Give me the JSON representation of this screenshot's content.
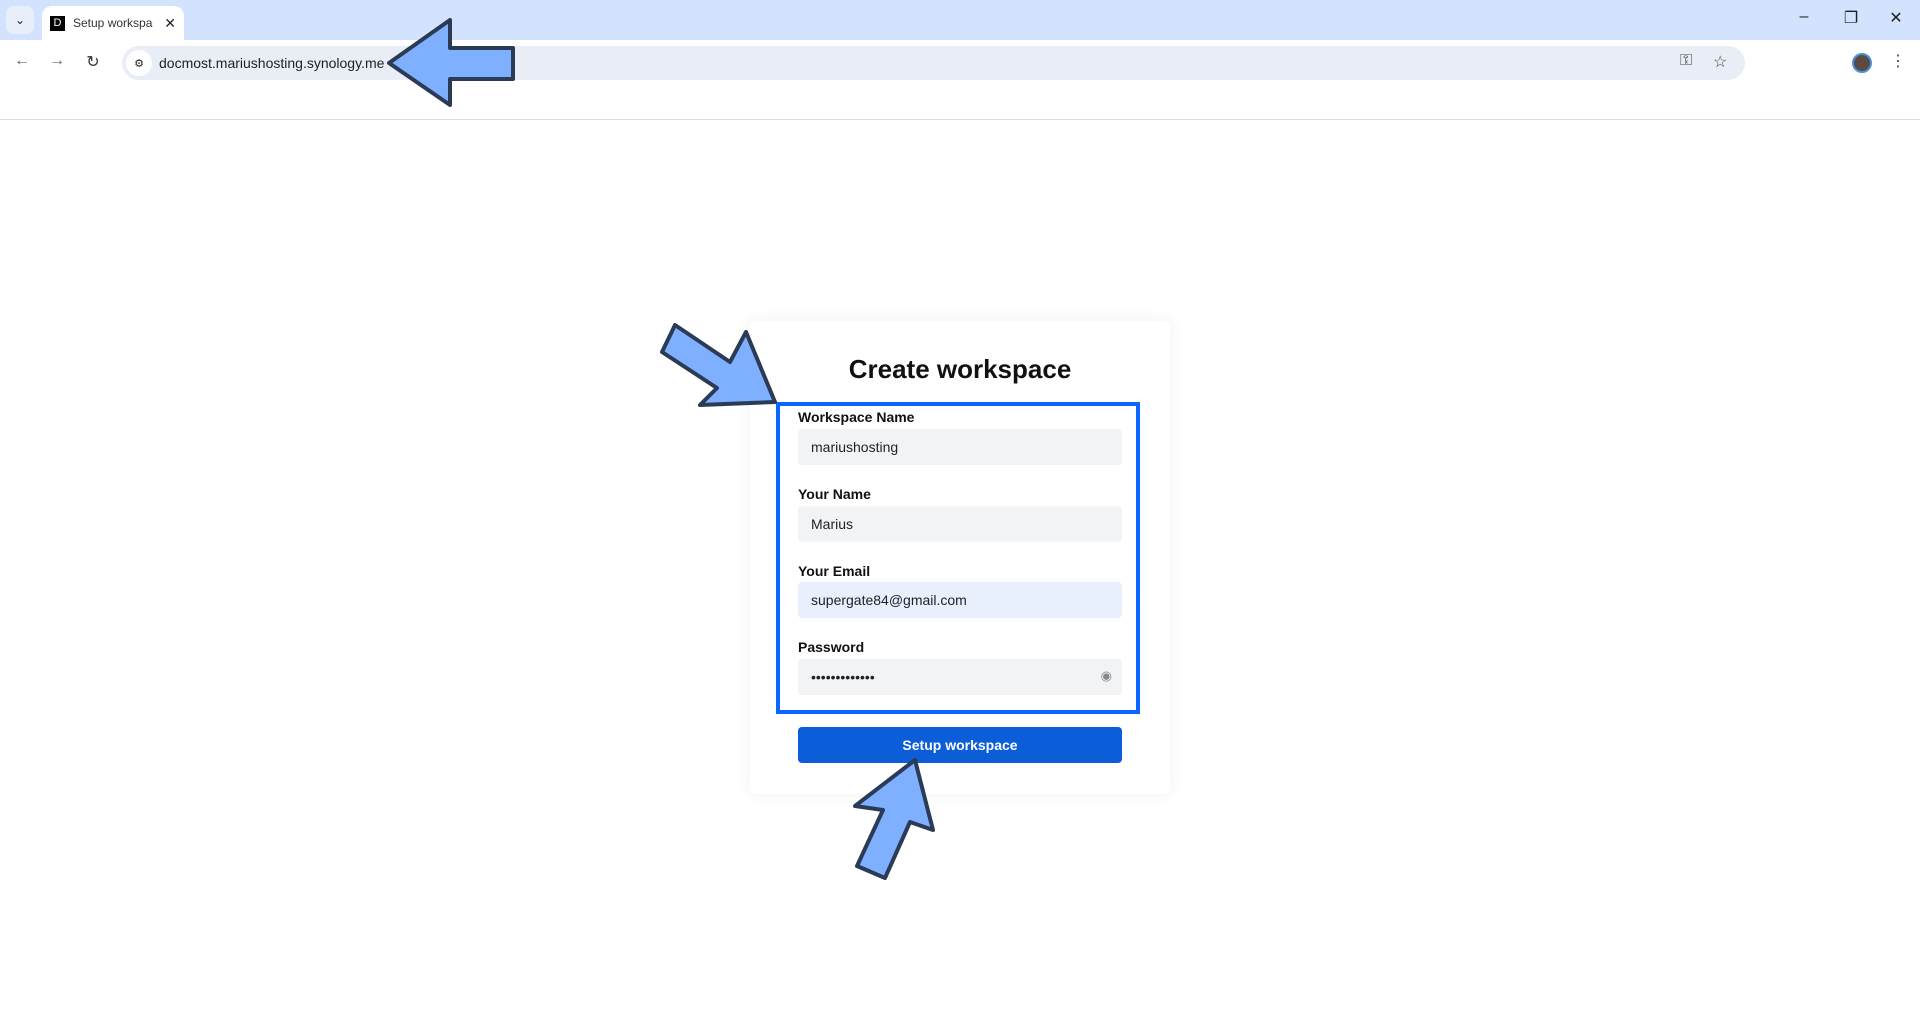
{
  "browser": {
    "tab_title": "Setup workspace",
    "favicon_letter": "D",
    "url": "docmost.mariushosting.synology.me",
    "icons": [
      "chevron-down-icon",
      "close-icon",
      "minimize-icon",
      "restore-icon",
      "back-icon",
      "forward-icon",
      "reload-icon",
      "site-info-icon",
      "key-icon",
      "star-icon",
      "avatar",
      "more-vert-icon"
    ]
  },
  "form": {
    "title": "Create workspace",
    "fields": [
      {
        "label": "Workspace Name",
        "value": "mariushosting"
      },
      {
        "label": "Your Name",
        "value": "Marius"
      },
      {
        "label": "Your Email",
        "value": "supergate84@gmail.com"
      },
      {
        "label": "Password",
        "value": "•••••••••••••"
      }
    ],
    "submit_label": "Setup workspace"
  },
  "annotation": {
    "highlight_color": "#0a66ff",
    "arrow_color": "#7eb0ff"
  }
}
